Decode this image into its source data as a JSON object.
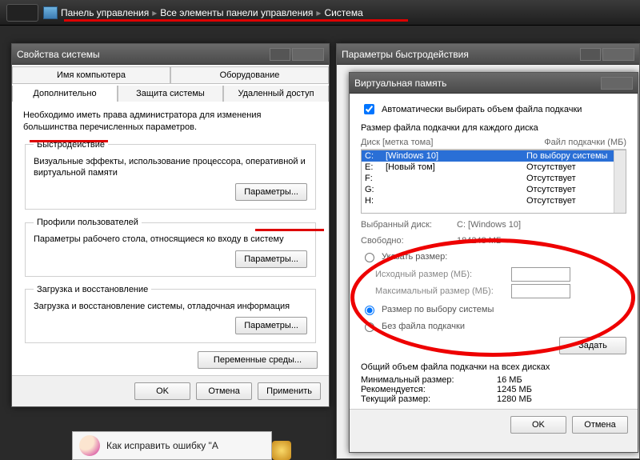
{
  "breadcrumb": {
    "items": [
      "Панель управления",
      "Все элементы панели управления",
      "Система"
    ]
  },
  "leftWindow": {
    "title": "Свойства системы",
    "tabsRow1": [
      "Имя компьютера",
      "Оборудование"
    ],
    "tabsRow2": [
      "Дополнительно",
      "Защита системы",
      "Удаленный доступ"
    ],
    "activeTab": "Дополнительно",
    "hint": "Необходимо иметь права администратора для изменения большинства перечисленных параметров.",
    "groups": {
      "perf": {
        "label": "Быстродействие",
        "desc": "Визуальные эффекты, использование процессора, оперативной и виртуальной памяти",
        "button": "Параметры..."
      },
      "profiles": {
        "label": "Профили пользователей",
        "desc": "Параметры рабочего стола, относящиеся ко входу в систему",
        "button": "Параметры..."
      },
      "boot": {
        "label": "Загрузка и восстановление",
        "desc": "Загрузка и восстановление системы, отладочная информация",
        "button": "Параметры..."
      }
    },
    "envBtn": "Переменные среды...",
    "footer": {
      "ok": "OK",
      "cancel": "Отмена",
      "apply": "Применить"
    }
  },
  "rightBack": {
    "title": "Параметры быстродействия"
  },
  "vm": {
    "title": "Виртуальная память",
    "autoChk": "Автоматически выбирать объем файла подкачки",
    "autoChecked": true,
    "listLabel": "Размер файла подкачки для каждого диска",
    "hdrDisk": "Диск [метка тома]",
    "hdrFile": "Файл подкачки (МБ)",
    "disks": [
      {
        "d": "C:",
        "l": "[Windows 10]",
        "p": "По выбору системы",
        "sel": true
      },
      {
        "d": "E:",
        "l": "[Новый том]",
        "p": "Отсутствует"
      },
      {
        "d": "F:",
        "l": "",
        "p": "Отсутствует"
      },
      {
        "d": "G:",
        "l": "",
        "p": "Отсутствует"
      },
      {
        "d": "H:",
        "l": "",
        "p": "Отсутствует"
      }
    ],
    "selLabel": "Выбранный диск:",
    "selVal": "C: [Windows 10]",
    "freeLabel": "Свободно:",
    "freeVal": "184248 МБ",
    "radioCustom": "Указать размер:",
    "initLabel": "Исходный размер (МБ):",
    "maxLabel": "Максимальный размер (МБ):",
    "radioSys": "Размер по выбору системы",
    "radioNone": "Без файла подкачки",
    "setBtn": "Задать",
    "totalsHdr": "Общий объем файла подкачки на всех дисках",
    "totals": [
      {
        "lbl": "Минимальный размер:",
        "val": "16 МБ"
      },
      {
        "lbl": "Рекомендуется:",
        "val": "1245 МБ"
      },
      {
        "lbl": "Текущий размер:",
        "val": "1280 МБ"
      }
    ],
    "footer": {
      "ok": "OK",
      "cancel": "Отмена"
    }
  },
  "bottom": {
    "text": "Как исправить ошибку \"A"
  }
}
